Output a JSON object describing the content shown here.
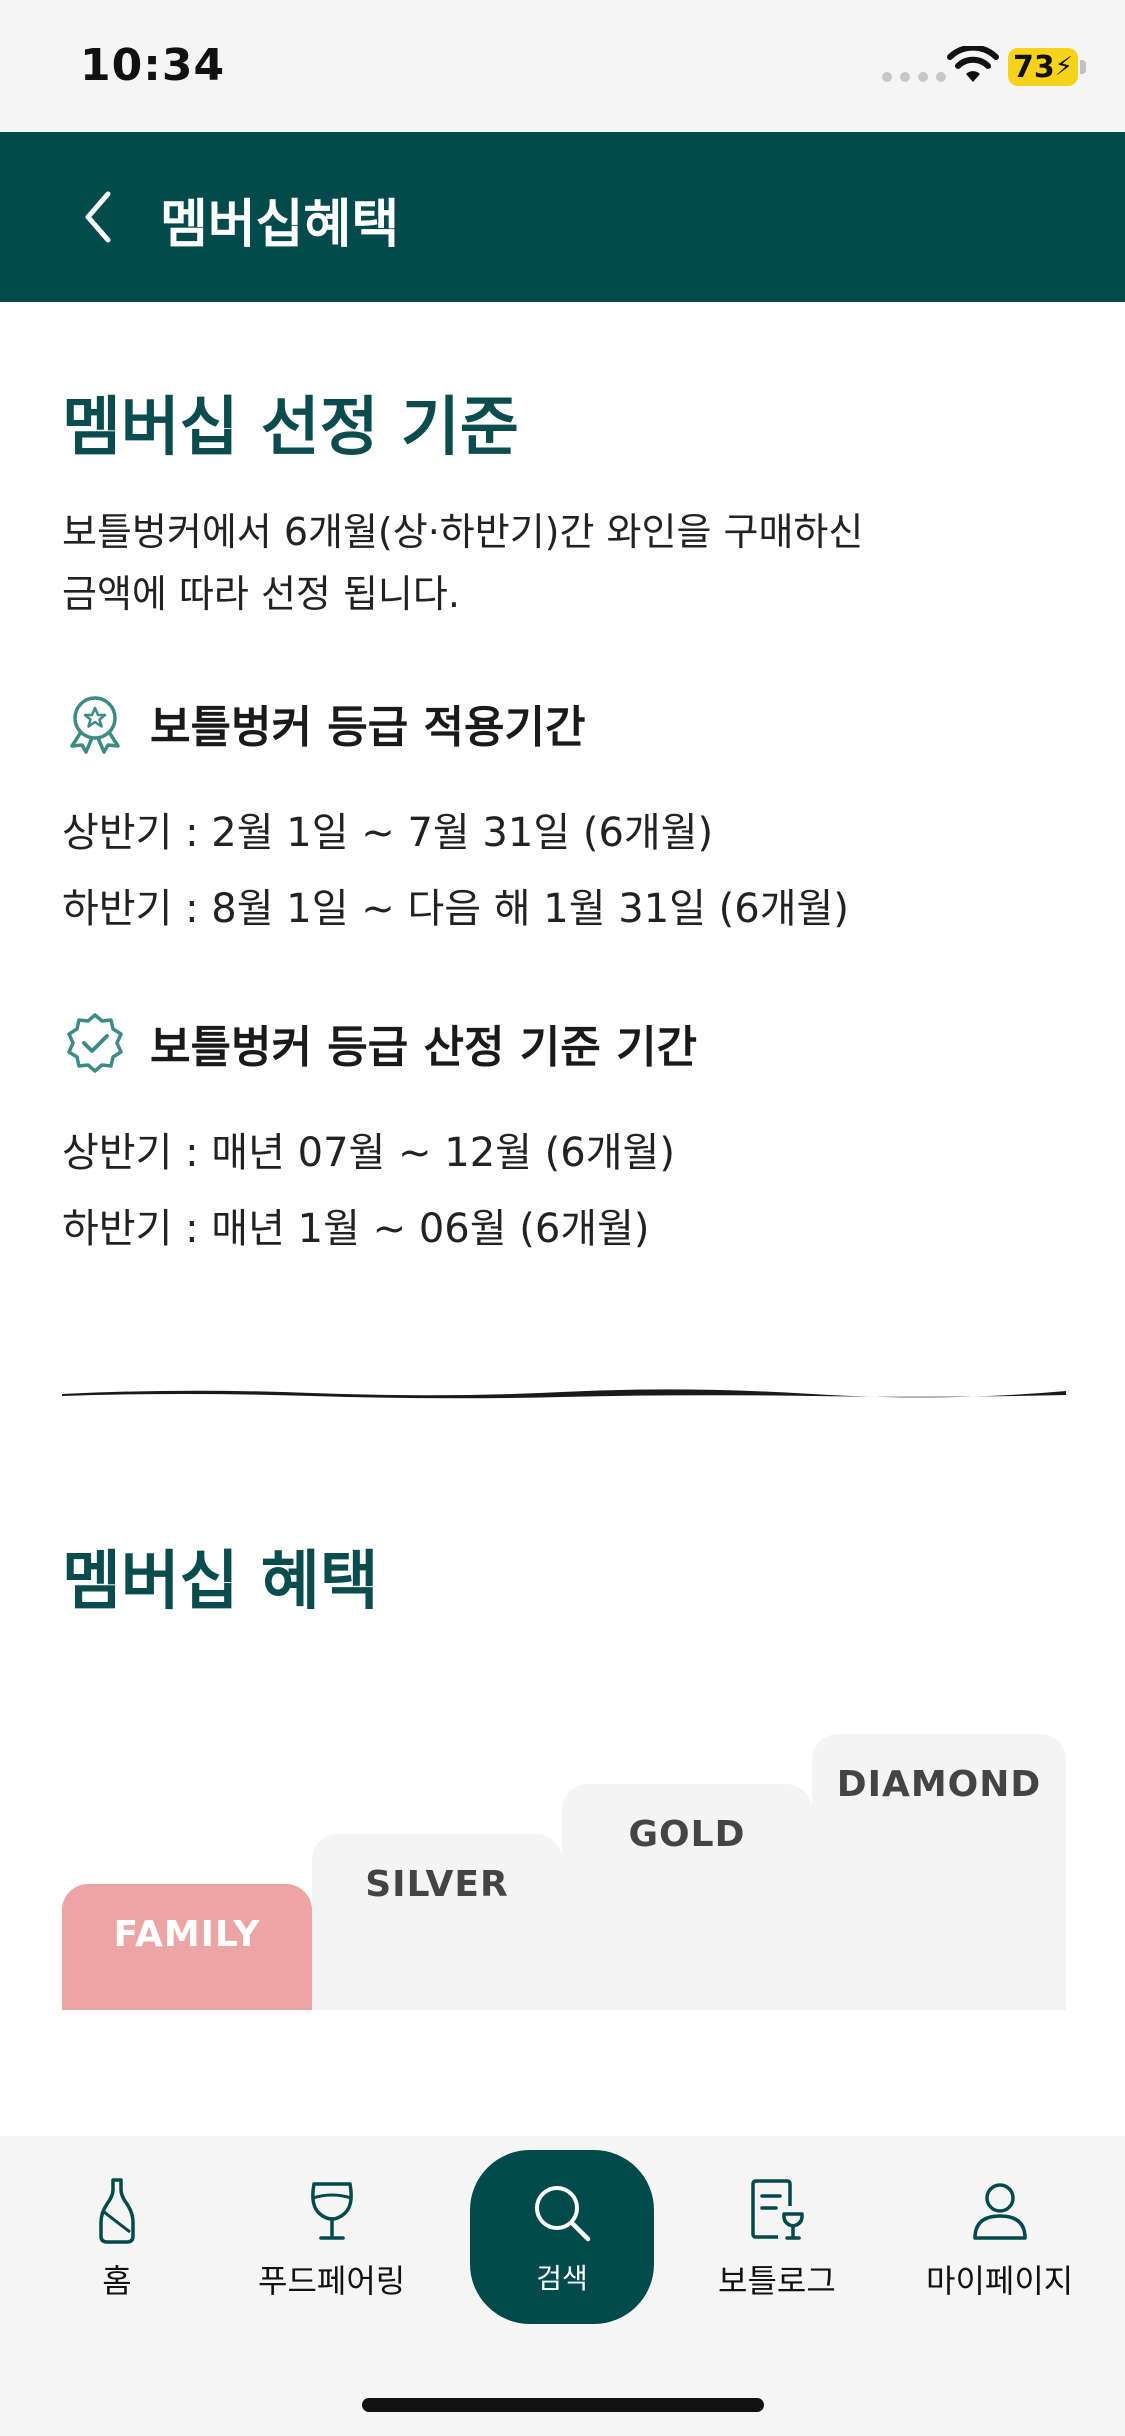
{
  "status_bar": {
    "time": "10:34",
    "battery": "73"
  },
  "header": {
    "title": "멤버십혜택"
  },
  "criteria": {
    "title": "멤버십 선정 기준",
    "description_line1": "보틀벙커에서 6개월(상·하반기)간 와인을 구매하신",
    "description_line2": "금액에 따라 선정 됩니다.",
    "application_period": {
      "title": "보틀벙커 등급 적용기간",
      "first_half": "상반기 :  2월 1일 ~ 7월 31일 (6개월)",
      "second_half": "하반기 :  8월 1일 ~ 다음 해 1월 31일 (6개월)"
    },
    "selection_period": {
      "title": "보틀벙커 등급 산정 기준 기간",
      "first_half": "상반기 : 매년 07월 ~ 12월 (6개월)",
      "second_half": "하반기 : 매년 1월  ~ 06월 (6개월)"
    }
  },
  "benefits": {
    "title": "멤버십 혜택",
    "tiers": [
      "FAMILY",
      "SILVER",
      "GOLD",
      "DIAMOND"
    ]
  },
  "bottom_nav": {
    "items": [
      "홈",
      "푸드페어링",
      "검색",
      "보틀로그",
      "마이페이지"
    ]
  },
  "colors": {
    "primary": "#034a4d",
    "family": "#eda4a5",
    "tier_bg": "#f4f4f4"
  }
}
